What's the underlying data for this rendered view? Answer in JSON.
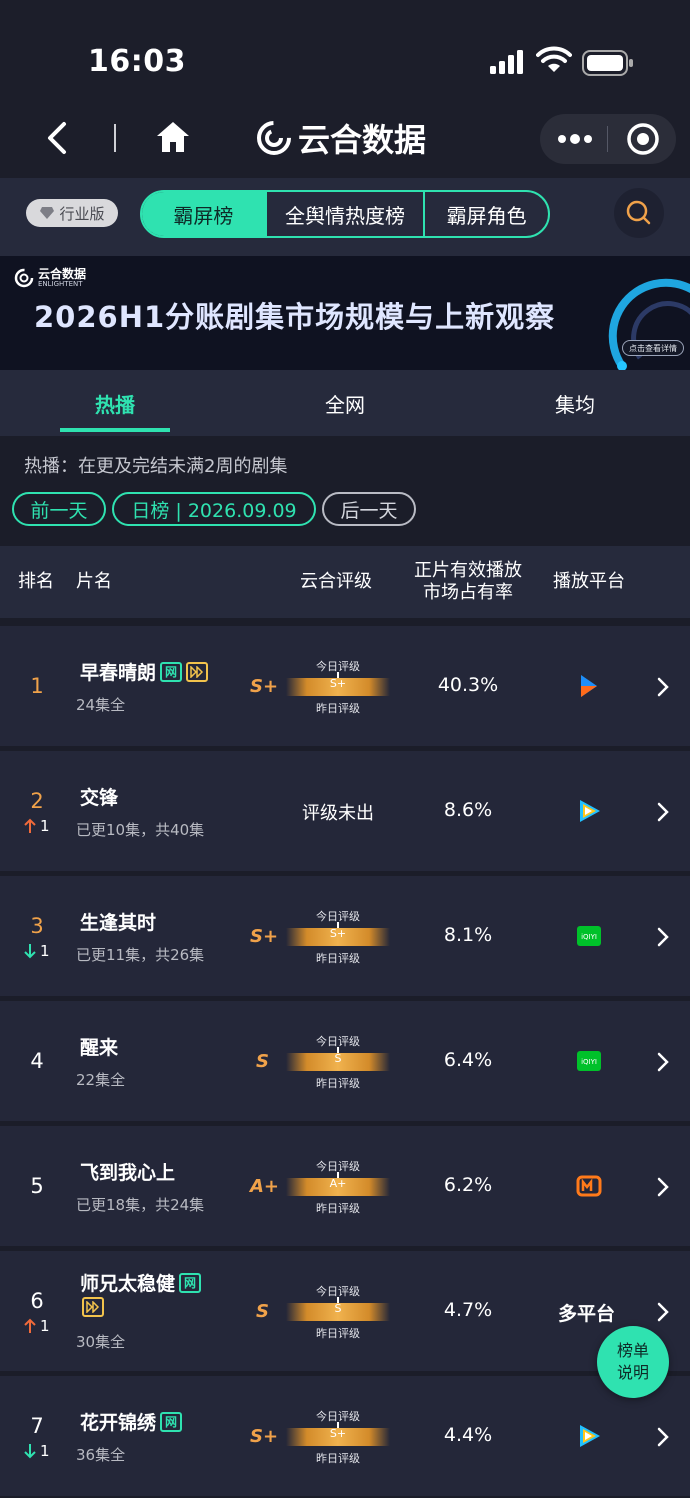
{
  "status": {
    "time": "16:03"
  },
  "nav": {
    "brand": "云合数据"
  },
  "tabbar": {
    "edition": "行业版",
    "segments": [
      "霸屏榜",
      "全舆情热度榜",
      "霸屏角色"
    ]
  },
  "banner": {
    "logo_text": "云合数据",
    "logo_sub": "ENLIGHTENT",
    "title": "2026H1分账剧集市场规模与上新观察",
    "button": "点击查看详情"
  },
  "subtabs": [
    "热播",
    "全网",
    "集均"
  ],
  "description": "热播：在更及完结未满2周的剧集",
  "dates": {
    "prev": "前一天",
    "current": "日榜 | 2026.09.09",
    "next": "后一天"
  },
  "table": {
    "headers": {
      "rank": "排名",
      "name": "片名",
      "rating": "云合评级",
      "share_line1": "正片有效播放",
      "share_line2": "市场占有率",
      "platform": "播放平台"
    },
    "rating_today": "今日评级",
    "rating_yesterday": "昨日评级",
    "rows": [
      {
        "rank": "1",
        "title": "早春晴朗",
        "net": "网",
        "sub": "24集全",
        "grade": "S+",
        "mark": "S+",
        "share": "40.3%",
        "change": "",
        "platform": "youku-icon"
      },
      {
        "rank": "2",
        "title": "交锋",
        "net": "",
        "sub": "已更10集，共40集",
        "grade": "",
        "mark": "",
        "rating_text": "评级未出",
        "share": "8.6%",
        "change": "1",
        "change_dir": "up",
        "platform": "tencent-video-icon"
      },
      {
        "rank": "3",
        "title": "生逢其时",
        "net": "",
        "sub": "已更11集，共26集",
        "grade": "S+",
        "mark": "S+",
        "share": "8.1%",
        "change": "1",
        "change_dir": "down",
        "platform": "iqiyi-icon"
      },
      {
        "rank": "4",
        "title": "醒来",
        "net": "",
        "sub": "22集全",
        "grade": "S",
        "mark": "S",
        "share": "6.4%",
        "change": "",
        "platform": "iqiyi-icon"
      },
      {
        "rank": "5",
        "title": "飞到我心上",
        "net": "",
        "sub": "已更18集，共24集",
        "grade": "A+",
        "mark": "A+",
        "share": "6.2%",
        "change": "",
        "platform": "mango-tv-icon"
      },
      {
        "rank": "6",
        "title": "师兄太稳健",
        "net": "网",
        "sub": "30集全",
        "grade": "S",
        "mark": "S",
        "share": "4.7%",
        "change": "1",
        "change_dir": "up",
        "platform_text": "多平台"
      },
      {
        "rank": "7",
        "title": "花开锦绣",
        "net": "网",
        "sub": "36集全",
        "grade": "S+",
        "mark": "S+",
        "share": "4.4%",
        "change": "1",
        "change_dir": "down",
        "platform": "tencent-video-icon"
      }
    ]
  },
  "fab": {
    "line1": "榜单",
    "line2": "说明"
  },
  "colors": {
    "accent": "#2fe2b0",
    "grade": "#f0a24a",
    "up": "#f06a3a",
    "down": "#2fe2b0",
    "bg": "#1b1d29",
    "row": "#242739"
  }
}
